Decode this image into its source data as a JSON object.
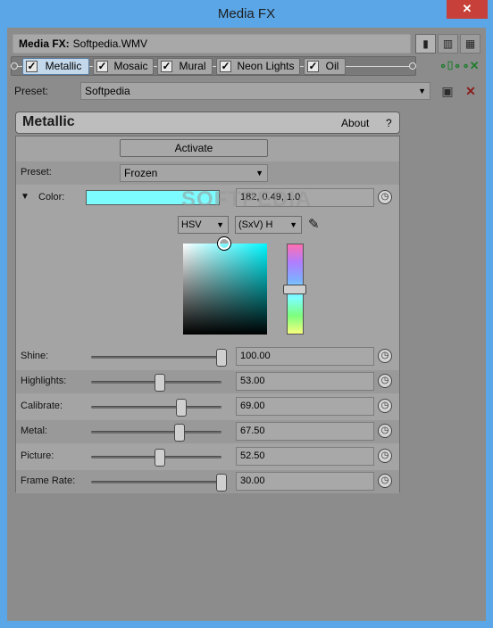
{
  "window": {
    "title": "Media FX",
    "close_glyph": "✕"
  },
  "header": {
    "label": "Media FX:",
    "file": "Softpedia.WMV"
  },
  "view_buttons": [
    "▮",
    "▥",
    "▦"
  ],
  "chain": {
    "effects": [
      {
        "label": "Metallic",
        "selected": true
      },
      {
        "label": "Mosaic",
        "selected": false
      },
      {
        "label": "Mural",
        "selected": false
      },
      {
        "label": "Neon Lights",
        "selected": false
      },
      {
        "label": "Oil",
        "selected": false
      }
    ],
    "add_icon": "plug-in-chain-icon",
    "remove_icon": "remove-plugin-icon"
  },
  "preset": {
    "label": "Preset:",
    "value": "Softpedia",
    "save_icon": "save-icon",
    "delete_icon": "delete-icon"
  },
  "plugin": {
    "name": "Metallic",
    "about": "About",
    "help": "?"
  },
  "panel": {
    "activate": "Activate",
    "preset_label": "Preset:",
    "preset_value": "Frozen",
    "color_label": "Color:",
    "color_value": "182, 0.49, 1.0",
    "color_hex": "#7dfcff",
    "color_model": "HSV",
    "color_mode": "(SxV) H",
    "params": [
      {
        "label": "Shine:",
        "value": "100.00",
        "level": 1.0
      },
      {
        "label": "Highlights:",
        "value": "53.00",
        "level": 0.53
      },
      {
        "label": "Calibrate:",
        "value": "69.00",
        "level": 0.69
      },
      {
        "label": "Metal:",
        "value": "67.50",
        "level": 0.675
      },
      {
        "label": "Picture:",
        "value": "52.50",
        "level": 0.525
      },
      {
        "label": "Frame Rate:",
        "value": "30.00",
        "level": 1.0
      }
    ]
  },
  "watermark": "SOFTPEDIA"
}
